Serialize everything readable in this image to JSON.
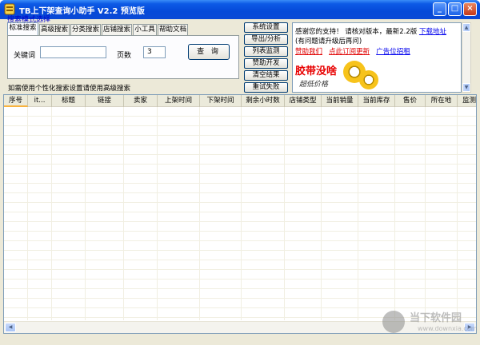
{
  "window": {
    "title": "TB上下架查询小助手  V2.2  预览版",
    "minimize": "_",
    "maximize": "□",
    "close": "×"
  },
  "search": {
    "mode_label": "搜索模式选择",
    "tabs": [
      {
        "label": "标准搜索",
        "active": true
      },
      {
        "label": "高级搜索",
        "active": false
      },
      {
        "label": "分类搜索",
        "active": false
      },
      {
        "label": "店铺搜索",
        "active": false
      },
      {
        "label": "小工具",
        "active": false
      },
      {
        "label": "帮助文档",
        "active": false
      }
    ],
    "keyword_label": "关键词",
    "keyword_value": "",
    "pages_label": "页数",
    "pages_value": "3",
    "query_button": "查 询",
    "hint": "如需使用个性化搜索设置请使用高级搜索"
  },
  "actions": [
    "系统设置",
    "导出/分析",
    "列表监测",
    "赞助开发",
    "清空结果",
    "重试失败"
  ],
  "info": {
    "thanks_text": "感谢您的支持！ 请核对版本，最新2.2版",
    "download_link": "下载地址",
    "upgrade_text": "(有问题请升级后再问)",
    "sponsor_link": "赞助我们",
    "subscribe_link": "点此订阅更新",
    "ad_link": "广告位招租",
    "ad_title": "胶带没啥",
    "ad_subtitle": "超低价格"
  },
  "table": {
    "columns": [
      "序号",
      "it...",
      "标题",
      "链接",
      "卖家",
      "上架时间",
      "下架时间",
      "剩余小时数",
      "店铺类型",
      "当前销量",
      "当前库存",
      "售价",
      "所在地",
      "监测"
    ],
    "rows": []
  },
  "watermark": {
    "brand": "当下软件园",
    "url": "www.downxia.com"
  },
  "colors": {
    "titlebar": "#0a49d6",
    "client": "#ece9d8",
    "link": "#0000ee",
    "ad_red": "#e80000"
  }
}
